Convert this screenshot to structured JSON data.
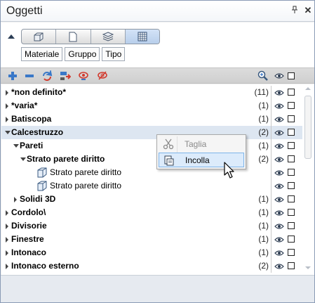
{
  "window": {
    "title": "Oggetti",
    "pin_glyph": "⌖",
    "close_glyph": "✕"
  },
  "view_modes": [
    {
      "icon": "box-3d-icon",
      "active": false
    },
    {
      "icon": "page-icon",
      "active": false
    },
    {
      "icon": "layers-icon",
      "active": false
    },
    {
      "icon": "grid-icon",
      "active": true
    }
  ],
  "filter_tags": [
    "Materiale",
    "Gruppo",
    "Tipo"
  ],
  "toolbar": {
    "icons": [
      "expand-all-icon",
      "collapse-all-icon",
      "refresh-icon",
      "transfer-icon",
      "visibility-on-icon",
      "visibility-off-icon"
    ],
    "zoom_icon": "zoom-icon"
  },
  "tree": [
    {
      "label": "*non definito*",
      "count": "(11)",
      "level": 0,
      "bold": true,
      "expander": "collapsed"
    },
    {
      "label": "*varia*",
      "count": "(1)",
      "level": 0,
      "bold": true,
      "expander": "collapsed"
    },
    {
      "label": "Batiscopa",
      "count": "(1)",
      "level": 0,
      "bold": true,
      "expander": "collapsed"
    },
    {
      "label": "Calcestruzzo",
      "count": "(2)",
      "level": 0,
      "bold": true,
      "expander": "expanded",
      "highlighted": true
    },
    {
      "label": "Pareti",
      "count": "(1)",
      "level": 1,
      "bold": true,
      "expander": "expanded"
    },
    {
      "label": "Strato parete diritto",
      "count": "(2)",
      "level": 2,
      "bold": true,
      "expander": "expanded"
    },
    {
      "label": "Strato parete diritto",
      "count": "",
      "level": 3,
      "bold": false,
      "expander": "none",
      "icon": "wall-layer-icon"
    },
    {
      "label": "Strato parete diritto",
      "count": "",
      "level": 3,
      "bold": false,
      "expander": "none",
      "icon": "wall-layer-icon"
    },
    {
      "label": "Solidi 3D",
      "count": "(1)",
      "level": 1,
      "bold": true,
      "expander": "collapsed"
    },
    {
      "label": "Cordolo\\",
      "count": "(1)",
      "level": 0,
      "bold": true,
      "expander": "collapsed"
    },
    {
      "label": "Divisorie",
      "count": "(1)",
      "level": 0,
      "bold": true,
      "expander": "collapsed"
    },
    {
      "label": "Finestre",
      "count": "(1)",
      "level": 0,
      "bold": true,
      "expander": "collapsed"
    },
    {
      "label": "Intonaco",
      "count": "(1)",
      "level": 0,
      "bold": true,
      "expander": "collapsed"
    },
    {
      "label": "Intonaco esterno",
      "count": "(2)",
      "level": 0,
      "bold": true,
      "expander": "collapsed"
    }
  ],
  "context_menu": {
    "items": [
      {
        "label": "Taglia",
        "icon": "scissors-icon",
        "disabled": true
      },
      {
        "label": "Incolla",
        "icon": "paste-icon",
        "disabled": false,
        "hover": true
      }
    ]
  }
}
